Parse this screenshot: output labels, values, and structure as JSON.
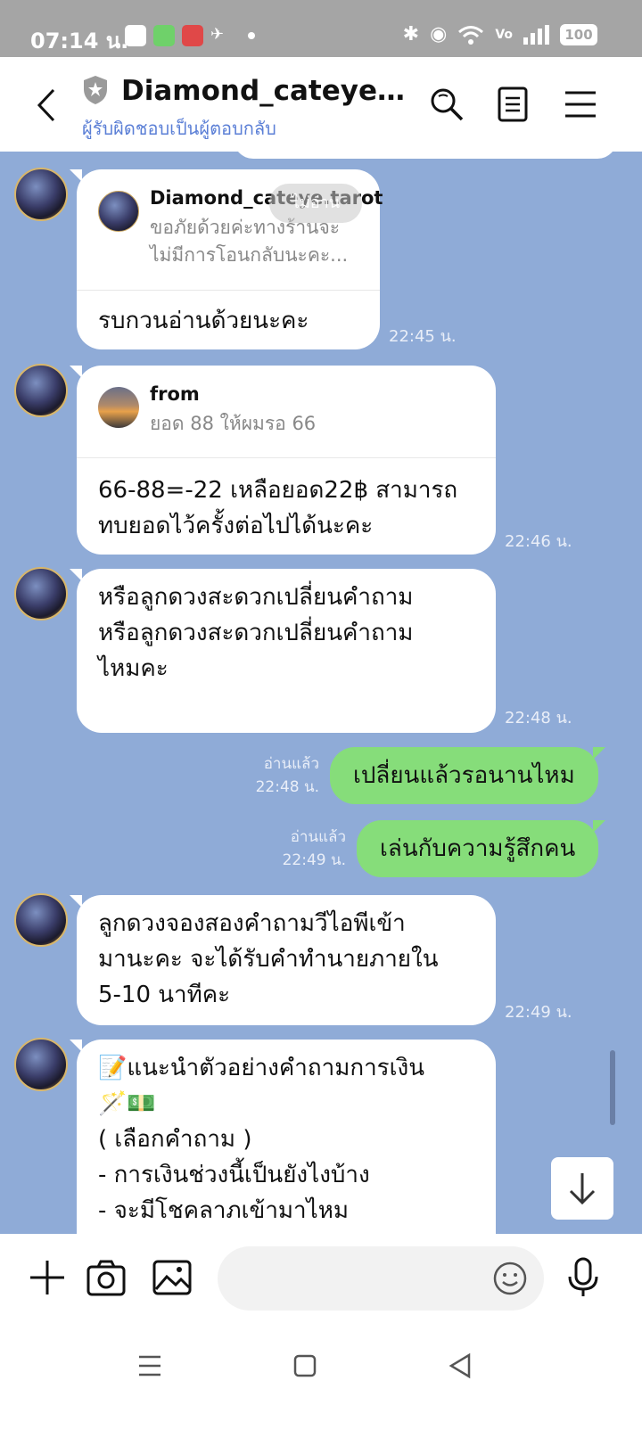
{
  "status_bar": {
    "time": "07:14 น.",
    "battery": "100",
    "icons": [
      "notification-icon",
      "bluetooth-icon",
      "location-icon",
      "wifi-icon",
      "volte-icon",
      "signal-icon",
      "battery-icon"
    ]
  },
  "header": {
    "title": "Diamond_cateye.ta...",
    "subtitle": "ผู้รับผิดชอบเป็นผู้ตอบกลับ",
    "icons": [
      "back-icon",
      "shield-icon",
      "search-icon",
      "notes-icon",
      "menu-icon"
    ]
  },
  "messages": [
    {
      "quote_name": "Diamond_cateye.tarot",
      "quote_text": "ขอภัยด้วยค่ะทางร้านจะ\nไม่มีการโอนกลับนะคะ...",
      "quote_overlay": "ไม่อ่าน",
      "text": "รบกวนอ่านด้วยนะคะ",
      "time": "22:45 น."
    },
    {
      "quote_name": "from",
      "quote_text": "ยอด 88 ให้ผมรอ 66",
      "text": "66-88=-22 เหลือยอด22฿ สามารถ\nทบยอดไว้ครั้งต่อไปได้นะคะ",
      "time": "22:46 น."
    },
    {
      "text": "หรือลูกดวงสะดวกเปลี่ยนคำถาม\nหรือลูกดวงสะดวกเปลี่ยนคำถาม\nไหมคะ",
      "time": "22:48 น."
    },
    {
      "text": "ลูกดวงจองสองคำถามวีไอพีเข้า\nมานะคะ จะได้รับคำทำนายภายใน\n5-10 นาทีคะ",
      "time": "22:49 น."
    },
    {
      "text": "📝แนะนำตัวอย่างคำถามการเงิน\n🪄💵\n ( เลือกคำถาม )\n- การเงินช่วงนี้เป็นยังไงบ้าง\n- จะมีโชคลาภเข้ามาไหม"
    }
  ],
  "outgoing": [
    {
      "text": "เปลี่ยนแล้วรอนานไหม",
      "read": "อ่านแล้ว",
      "time": "22:48 น."
    },
    {
      "text": "เล่นกับความรู้สึกคน",
      "read": "อ่านแล้ว",
      "time": "22:49 น."
    }
  ],
  "input": {
    "placeholder": ""
  }
}
